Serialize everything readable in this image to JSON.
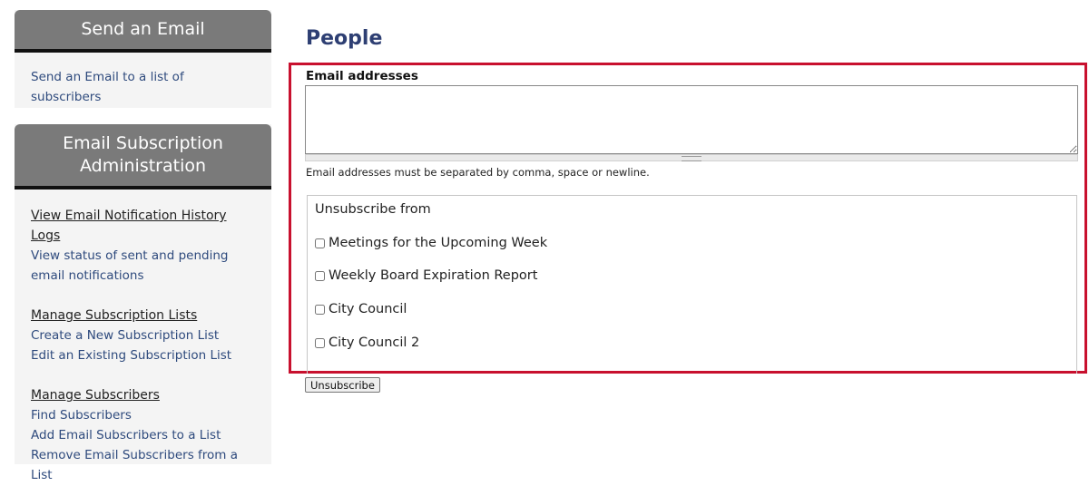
{
  "sidebar": {
    "send_panel": {
      "title": "Send an Email",
      "links": [
        "Send an Email to a list of subscribers"
      ]
    },
    "admin_panel": {
      "title": "Email Subscription Administration",
      "groups": [
        {
          "heading": "View Email Notification History Logs",
          "links": [
            "View status of sent and pending email notifications"
          ]
        },
        {
          "heading": "Manage Subscription Lists",
          "links": [
            "Create a New Subscription List",
            "Edit an Existing Subscription List"
          ]
        },
        {
          "heading": "Manage Subscribers",
          "links": [
            "Find Subscribers",
            "Add Email Subscribers to a List",
            "Remove Email Subscribers from a List"
          ]
        }
      ]
    }
  },
  "main": {
    "title": "People",
    "email_label": "Email addresses",
    "email_value": "",
    "email_hint": "Email addresses must be separated by comma, space or newline.",
    "unsubscribe_title": "Unsubscribe from",
    "options": [
      {
        "label": "Meetings for the Upcoming Week",
        "checked": false
      },
      {
        "label": "Weekly Board Expiration Report",
        "checked": false
      },
      {
        "label": "City Council",
        "checked": false
      },
      {
        "label": "City Council 2",
        "checked": false
      }
    ],
    "submit_label": "Unsubscribe"
  },
  "colors": {
    "highlight": "#c8102e",
    "panel_header": "#7a7a7a",
    "link": "#2e4a7d",
    "title": "#2e3f73"
  }
}
